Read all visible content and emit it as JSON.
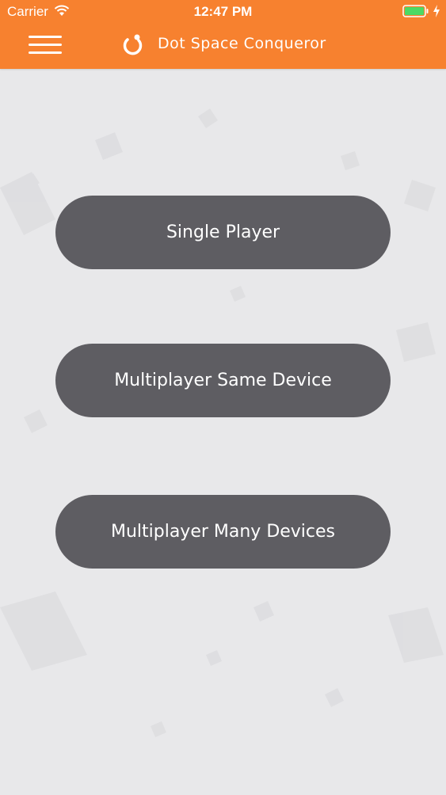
{
  "status_bar": {
    "carrier": "Carrier",
    "time": "12:47 PM"
  },
  "header": {
    "title": "Dot Space Conqueror",
    "menu_icon": "hamburger-menu-icon",
    "logo_icon": "dot-logo-icon",
    "color": "#f7812f"
  },
  "menu": {
    "single_player": "Single Player",
    "multiplayer_same_device": "Multiplayer Same Device",
    "multiplayer_many_devices": "Multiplayer Many Devices"
  },
  "colors": {
    "button": "#5e5d62",
    "background": "#e8e8ea",
    "text": "#ffffff"
  }
}
